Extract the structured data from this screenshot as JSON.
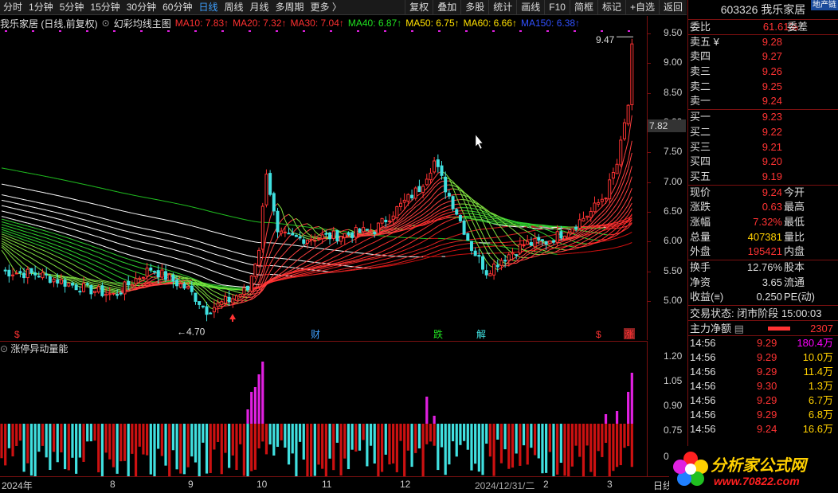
{
  "toolbar": {
    "periods": [
      "分时",
      "1分钟",
      "5分钟",
      "15分钟",
      "30分钟",
      "60分钟",
      "日线",
      "周线",
      "月线",
      "多周期",
      "更多 〉"
    ],
    "active_period": "日线",
    "buttons": [
      "复权",
      "叠加",
      "多股",
      "统计",
      "画线",
      "F10",
      "简框",
      "标记",
      "+自选",
      "返回"
    ]
  },
  "legend": {
    "title": "我乐家居 (日线,前复权)",
    "indicator": "幻彩均线主图",
    "ma": [
      {
        "text": "MA10: 7.83↑",
        "color": "#ff3030"
      },
      {
        "text": "MA20: 7.32↑",
        "color": "#ff3030"
      },
      {
        "text": "MA30: 7.04↑",
        "color": "#ff3030"
      },
      {
        "text": "MA40: 6.87↑",
        "color": "#20e020"
      },
      {
        "text": "MA50: 6.75↑",
        "color": "#ffe000"
      },
      {
        "text": "MA60: 6.66↑",
        "color": "#ffe000"
      },
      {
        "text": "MA150: 6.38↑",
        "color": "#3050ff"
      }
    ]
  },
  "price_axis": {
    "ticks": [
      "9.50",
      "9.00",
      "8.50",
      "8.00",
      "7.50",
      "7.00",
      "6.50",
      "6.00",
      "5.50",
      "5.00"
    ],
    "last_price": "7.82"
  },
  "annotations": {
    "high": "9.47",
    "low": "←4.70",
    "markers": [
      {
        "text": "$",
        "color": "#ff3333"
      },
      {
        "text": "财",
        "color": "#3fa0ff"
      },
      {
        "text": "跌",
        "color": "#20e020"
      },
      {
        "text": "解",
        "color": "#40e0e0"
      },
      {
        "text": "$",
        "color": "#ff3333"
      },
      {
        "text": "涨",
        "color": "#ff3333"
      }
    ]
  },
  "volume_panel": {
    "title": "涨停异动量能",
    "ticks": [
      "1.20",
      "1.05",
      "0.90",
      "0.75",
      "0.60",
      "0"
    ]
  },
  "date_axis": {
    "labels": [
      "2024年",
      "8",
      "9",
      "10",
      "11",
      "12",
      "2024/12/31/二",
      "2",
      "3",
      "日线"
    ]
  },
  "quote": {
    "code": "603326",
    "name": "我乐家居",
    "sector": "地产链",
    "weibi_label": "委比",
    "weibi_value": "61.61%",
    "weicha_label": "委差",
    "asks": [
      {
        "label": "卖五 ¥",
        "price": "9.28"
      },
      {
        "label": "卖四",
        "price": "9.27"
      },
      {
        "label": "卖三",
        "price": "9.26"
      },
      {
        "label": "卖二",
        "price": "9.25"
      },
      {
        "label": "卖一",
        "price": "9.24"
      }
    ],
    "bids": [
      {
        "label": "买一",
        "price": "9.23"
      },
      {
        "label": "买二",
        "price": "9.22"
      },
      {
        "label": "买三",
        "price": "9.21"
      },
      {
        "label": "买四",
        "price": "9.20"
      },
      {
        "label": "买五",
        "price": "9.19"
      }
    ],
    "stats": [
      {
        "l1": "现价",
        "v1": "9.24",
        "c1": "red",
        "l2": "今开"
      },
      {
        "l1": "涨跌",
        "v1": "0.63",
        "c1": "red",
        "l2": "最高"
      },
      {
        "l1": "涨幅",
        "v1": "7.32%",
        "c1": "red",
        "l2": "最低"
      },
      {
        "l1": "总量",
        "v1": "407381",
        "c1": "yellow",
        "l2": "量比"
      },
      {
        "l1": "外盘",
        "v1": "195421",
        "c1": "red",
        "l2": "内盘"
      }
    ],
    "stats2": [
      {
        "l1": "换手",
        "v1": "12.76%",
        "l2": "股本"
      },
      {
        "l1": "净资",
        "v1": "3.65",
        "l2": "流通"
      },
      {
        "l1": "收益(≡)",
        "v1": "0.250",
        "l2": "PE(动)"
      }
    ],
    "trade_status_label": "交易状态:",
    "trade_status_value": "闭市阶段 15:00:03",
    "flow_label": "主力净额",
    "flow_value": "2307",
    "ticks": [
      {
        "time": "14:56",
        "price": "9.29",
        "vol": "180.4万",
        "color": "#ff00ff"
      },
      {
        "time": "14:56",
        "price": "9.29",
        "vol": "10.0万",
        "color": "#ffd000"
      },
      {
        "time": "14:56",
        "price": "9.29",
        "vol": "11.4万",
        "color": "#ffd000"
      },
      {
        "time": "14:56",
        "price": "9.30",
        "vol": "1.3万",
        "color": "#ffd000"
      },
      {
        "time": "14:56",
        "price": "9.29",
        "vol": "6.7万",
        "color": "#ffd000"
      },
      {
        "time": "14:56",
        "price": "9.29",
        "vol": "6.8万",
        "color": "#ffd000"
      },
      {
        "time": "14:56",
        "price": "9.24",
        "vol": "16.6万",
        "color": "#ffd000"
      }
    ]
  },
  "watermark": {
    "text": "分析家公式网",
    "url": "www.70822.com"
  },
  "colors": {
    "up": "#ff3333",
    "down": "#40e0e0",
    "volume_up": "#cc1111",
    "volume_down": "#40e0e0",
    "volume_spike": "#e020e0"
  }
}
